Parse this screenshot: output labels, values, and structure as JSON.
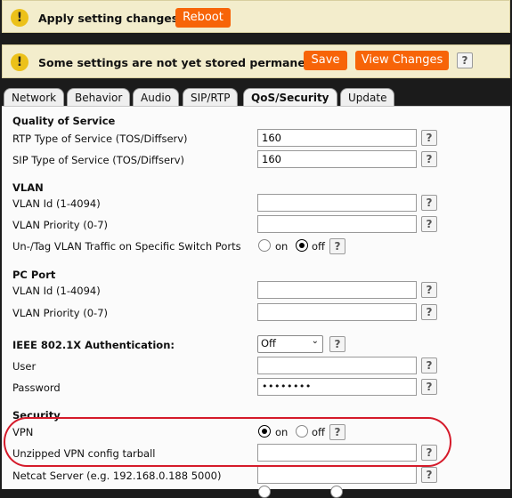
{
  "banner_reboot": {
    "icon": "warning-icon",
    "icon_glyph": "!",
    "text": "Apply setting changes?",
    "reboot_label": "Reboot"
  },
  "banner_save": {
    "icon": "warning-icon",
    "icon_glyph": "!",
    "text": "Some settings are not yet stored permanently.",
    "save_label": "Save",
    "view_changes_label": "View Changes",
    "help": "?"
  },
  "tabs": [
    {
      "label": "Network"
    },
    {
      "label": "Behavior"
    },
    {
      "label": "Audio"
    },
    {
      "label": "SIP/RTP"
    },
    {
      "label": "QoS/Security",
      "active": true
    },
    {
      "label": "Update"
    }
  ],
  "help_glyph": "?",
  "qos": {
    "heading": "Quality of Service",
    "rtp_label": "RTP Type of Service (TOS/Diffserv)",
    "rtp_value": "160",
    "sip_label": "SIP Type of Service (TOS/Diffserv)",
    "sip_value": "160"
  },
  "vlan": {
    "heading": "VLAN",
    "id_label": "VLAN Id (1-4094)",
    "id_value": "",
    "priority_label": "VLAN Priority (0-7)",
    "priority_value": "",
    "untag_label": "Un-/Tag VLAN Traffic on Specific Switch Ports",
    "on_label": "on",
    "off_label": "off",
    "selected": "off"
  },
  "pc_port": {
    "heading": "PC Port",
    "id_label": "VLAN Id (1-4094)",
    "id_value": "",
    "priority_label": "VLAN Priority (0-7)",
    "priority_value": ""
  },
  "ieee": {
    "heading": "IEEE 802.1X Authentication:",
    "select_value": "Off",
    "user_label": "User",
    "user_value": "",
    "password_label": "Password",
    "password_value": "••••••••"
  },
  "security": {
    "heading": "Security",
    "vpn_label": "VPN",
    "on_label": "on",
    "off_label": "off",
    "vpn_selected": "on",
    "tarball_label": "Unzipped VPN config tarball",
    "tarball_value": "",
    "netcat_label": "Netcat Server (e.g. 192.168.0.188 5000)",
    "netcat_value": ""
  },
  "colors": {
    "accent": "#f76408",
    "highlight": "#d51a2a",
    "banner_bg": "#f3edcc",
    "warn": "#ecc11a"
  }
}
